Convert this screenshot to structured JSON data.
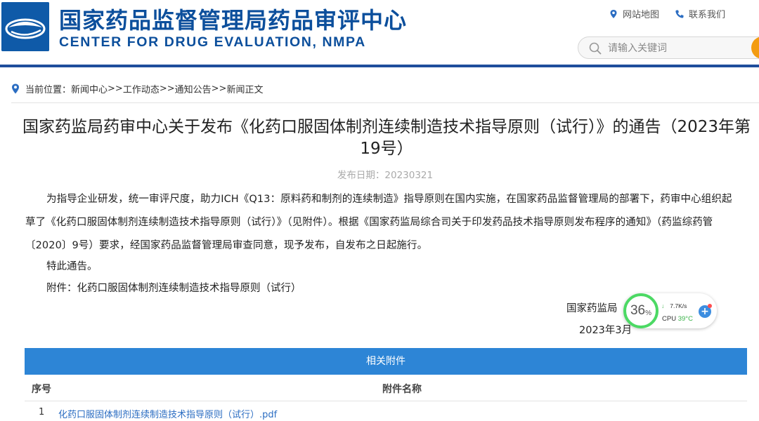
{
  "header": {
    "title_cn": "国家药品监督管理局药品审评中心",
    "title_en": "CENTER FOR DRUG EVALUATION, NMPA",
    "links": [
      {
        "label": "网站地图",
        "icon": "location-pin-icon"
      },
      {
        "label": "联系我们",
        "icon": "phone-icon"
      }
    ],
    "search": {
      "placeholder": "请输入关键词",
      "value": ""
    }
  },
  "breadcrumb": {
    "prefix": "当前位置：",
    "items": [
      "新闻中心",
      "工作动态",
      "通知公告",
      "新闻正文"
    ],
    "separator": ">>"
  },
  "article": {
    "title": "国家药监局药审中心关于发布《化药口服固体制剂连续制造技术指导原则（试行）》的通告（2023年第19号）",
    "date_label": "发布日期：",
    "date": "20230321",
    "paragraph1": "为指导企业研发，统一审评尺度，助力ICH《Q13：原料药和制剂的连续制造》指导原则在国内实施，在国家药品监督管理局的部署下，药审中心组织起草了《化药口服固体制剂连续制造技术指导原则（试行）》（见附件）。根据《国家药监局综合司关于印发药品技术指导原则发布程序的通知》（药监综药管〔2020〕9号）要求，经国家药品监督管理局审查同意，现予发布，自发布之日起施行。",
    "paragraph2": "特此通告。",
    "paragraph3": "附件：化药口服固体制剂连续制造技术指导原则（试行）",
    "signature_org": "国家药监局",
    "signature_date": "2023年3月"
  },
  "monitor_widget": {
    "cpu_percent": "36",
    "percent_sign": "%",
    "net_speed": "7.7K/s",
    "cpu_label": "CPU",
    "cpu_temp": "39°C",
    "plus": "+",
    "colors": {
      "ring": "#4cd964",
      "temp": "#3bb34a",
      "button": "#3c8de0"
    }
  },
  "attachments": {
    "header": "相关附件",
    "col_no": "序号",
    "col_name": "附件名称",
    "rows": [
      {
        "no": "1",
        "name": "化药口服固体制剂连续制造技术指导原则（试行）.pdf"
      }
    ]
  },
  "colors": {
    "brand": "#0c4f9c",
    "accent": "#2d85d6",
    "search_button": "#f39c12",
    "link": "#2b6dc2"
  }
}
